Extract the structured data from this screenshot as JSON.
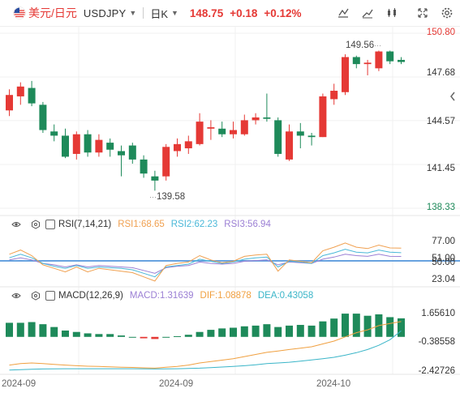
{
  "header": {
    "symbol_cn": "美元/日元",
    "symbol_en": "USDJPY",
    "period": "日K",
    "price": "148.75",
    "change": "+0.18",
    "change_pct": "+0.12%"
  },
  "toolbar": {
    "icons": [
      "indicator-icon",
      "line-icon",
      "draw-icon",
      "expand-icon",
      "settings-icon"
    ]
  },
  "price_axis": {
    "labels": [
      "150.80",
      "147.68",
      "144.57",
      "141.45",
      "138.33"
    ],
    "ticks": [
      150.8,
      147.68,
      144.57,
      141.45,
      138.33
    ],
    "high_label": "149.56",
    "low_label": "139.58"
  },
  "rsi": {
    "title": "RSI(7,14,21)",
    "rsi1": "RSI1:68.65",
    "rsi2": "RSI2:62.23",
    "rsi3": "RSI3:56.94",
    "axis": [
      "77.00",
      "50.00",
      "23.04"
    ],
    "axis_extra": "51.00"
  },
  "macd": {
    "title": "MACD(12,26,9)",
    "macd": "MACD:1.31639",
    "dif": "DIF:1.08878",
    "dea": "DEA:0.43058",
    "axis": [
      "1.65610",
      "-0.38558",
      "-2.42726"
    ]
  },
  "xaxis": [
    "2024-09",
    "2024-09",
    "2024-10"
  ],
  "colors": {
    "up": "#e53935",
    "down": "#1e8a5a",
    "rsi1": "#f0a050",
    "rsi2": "#4ab8d8",
    "rsi3": "#9b7fd4",
    "dif": "#f0a040",
    "dea": "#3ab5c8"
  },
  "chart_data": {
    "type": "candlestick",
    "candles": [
      {
        "o": 145.3,
        "h": 146.8,
        "l": 144.9,
        "c": 146.4
      },
      {
        "o": 146.3,
        "h": 147.3,
        "l": 145.7,
        "c": 147.0
      },
      {
        "o": 146.9,
        "h": 147.4,
        "l": 145.6,
        "c": 145.8
      },
      {
        "o": 145.7,
        "h": 145.9,
        "l": 143.7,
        "c": 143.9
      },
      {
        "o": 143.8,
        "h": 144.3,
        "l": 143.1,
        "c": 143.5
      },
      {
        "o": 143.5,
        "h": 144.0,
        "l": 141.9,
        "c": 142.0
      },
      {
        "o": 142.2,
        "h": 143.8,
        "l": 141.8,
        "c": 143.6
      },
      {
        "o": 143.6,
        "h": 143.9,
        "l": 142.0,
        "c": 142.3
      },
      {
        "o": 142.3,
        "h": 143.6,
        "l": 142.0,
        "c": 143.2
      },
      {
        "o": 143.0,
        "h": 143.3,
        "l": 142.0,
        "c": 142.5
      },
      {
        "o": 142.4,
        "h": 142.8,
        "l": 140.6,
        "c": 142.1
      },
      {
        "o": 142.8,
        "h": 143.0,
        "l": 141.5,
        "c": 141.8
      },
      {
        "o": 141.8,
        "h": 142.1,
        "l": 140.5,
        "c": 140.8
      },
      {
        "o": 140.6,
        "h": 141.0,
        "l": 139.58,
        "c": 140.3
      },
      {
        "o": 140.6,
        "h": 142.9,
        "l": 140.3,
        "c": 142.7
      },
      {
        "o": 142.4,
        "h": 143.3,
        "l": 142.0,
        "c": 142.9
      },
      {
        "o": 142.6,
        "h": 143.5,
        "l": 142.2,
        "c": 143.1
      },
      {
        "o": 142.9,
        "h": 145.1,
        "l": 142.8,
        "c": 144.5
      },
      {
        "o": 144.0,
        "h": 144.6,
        "l": 143.2,
        "c": 144.1
      },
      {
        "o": 144.0,
        "h": 144.5,
        "l": 143.4,
        "c": 143.6
      },
      {
        "o": 143.6,
        "h": 144.5,
        "l": 143.3,
        "c": 143.9
      },
      {
        "o": 143.6,
        "h": 145.0,
        "l": 143.5,
        "c": 144.6
      },
      {
        "o": 144.6,
        "h": 145.1,
        "l": 144.3,
        "c": 144.8
      },
      {
        "o": 144.8,
        "h": 146.5,
        "l": 144.5,
        "c": 144.7
      },
      {
        "o": 144.6,
        "h": 144.8,
        "l": 142.0,
        "c": 142.2
      },
      {
        "o": 141.8,
        "h": 144.3,
        "l": 141.7,
        "c": 143.8
      },
      {
        "o": 143.8,
        "h": 144.4,
        "l": 142.6,
        "c": 143.5
      },
      {
        "o": 143.5,
        "h": 143.7,
        "l": 142.8,
        "c": 143.4
      },
      {
        "o": 143.4,
        "h": 146.5,
        "l": 143.4,
        "c": 146.3
      },
      {
        "o": 146.1,
        "h": 147.2,
        "l": 145.7,
        "c": 146.7
      },
      {
        "o": 146.6,
        "h": 149.3,
        "l": 146.4,
        "c": 149.1
      },
      {
        "o": 149.1,
        "h": 149.2,
        "l": 148.3,
        "c": 148.6
      },
      {
        "o": 148.6,
        "h": 148.9,
        "l": 147.8,
        "c": 148.7
      },
      {
        "o": 148.3,
        "h": 149.56,
        "l": 148.1,
        "c": 149.5
      },
      {
        "o": 149.5,
        "h": 149.56,
        "l": 148.6,
        "c": 148.8
      },
      {
        "o": 148.9,
        "h": 149.1,
        "l": 148.6,
        "c": 148.75
      }
    ],
    "rsi1": [
      60,
      66,
      58,
      45,
      40,
      35,
      42,
      35,
      40,
      38,
      36,
      34,
      28,
      22,
      44,
      47,
      49,
      58,
      52,
      48,
      50,
      57,
      59,
      60,
      36,
      52,
      50,
      48,
      65,
      70,
      76,
      70,
      68,
      73,
      69,
      68.65
    ],
    "rsi2": [
      55,
      60,
      55,
      47,
      43,
      40,
      44,
      40,
      42,
      41,
      40,
      38,
      33,
      28,
      42,
      44,
      46,
      53,
      50,
      47,
      49,
      53,
      55,
      56,
      42,
      50,
      49,
      47,
      58,
      62,
      67,
      63,
      62,
      66,
      63,
      62.23
    ],
    "rsi3": [
      52,
      55,
      52,
      47,
      45,
      42,
      45,
      42,
      44,
      43,
      42,
      41,
      37,
      33,
      41,
      43,
      44,
      49,
      47,
      46,
      47,
      50,
      51,
      52,
      45,
      49,
      48,
      47,
      53,
      56,
      60,
      58,
      57,
      60,
      57,
      56.94
    ],
    "macd_hist": [
      1.0,
      1.0,
      1.05,
      0.9,
      0.7,
      0.45,
      0.35,
      0.25,
      0.2,
      0.2,
      0.1,
      0.0,
      -0.1,
      -0.15,
      0.0,
      0.05,
      0.15,
      0.35,
      0.5,
      0.6,
      0.65,
      0.75,
      0.8,
      0.9,
      0.7,
      0.8,
      0.85,
      0.8,
      1.1,
      1.3,
      1.65,
      1.65,
      1.5,
      1.6,
      1.4,
      1.31639
    ],
    "dif": [
      -2.0,
      -1.9,
      -1.85,
      -1.9,
      -1.95,
      -2.0,
      -2.05,
      -2.08,
      -2.1,
      -2.12,
      -2.15,
      -2.17,
      -2.2,
      -2.22,
      -2.15,
      -2.1,
      -2.0,
      -1.85,
      -1.75,
      -1.65,
      -1.55,
      -1.4,
      -1.25,
      -1.1,
      -1.0,
      -0.9,
      -0.8,
      -0.7,
      -0.5,
      -0.3,
      0.0,
      0.3,
      0.5,
      0.8,
      0.95,
      1.08878
    ],
    "dea": [
      -2.35,
      -2.33,
      -2.3,
      -2.28,
      -2.27,
      -2.26,
      -2.26,
      -2.26,
      -2.26,
      -2.26,
      -2.26,
      -2.26,
      -2.27,
      -2.28,
      -2.27,
      -2.26,
      -2.24,
      -2.22,
      -2.18,
      -2.14,
      -2.1,
      -2.05,
      -1.98,
      -1.9,
      -1.85,
      -1.8,
      -1.72,
      -1.64,
      -1.55,
      -1.45,
      -1.3,
      -1.12,
      -0.9,
      -0.6,
      -0.2,
      0.43058
    ]
  }
}
